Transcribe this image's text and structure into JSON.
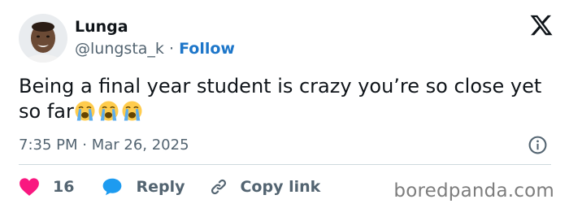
{
  "author": {
    "name": "Lunga",
    "handle": "@lungsta_k",
    "separator": "·",
    "follow_label": "Follow"
  },
  "tweet": {
    "text": "Being a final year student is crazy you’re so close yet so far",
    "emojis": [
      "loudly-crying-face",
      "loudly-crying-face",
      "loudly-crying-face"
    ],
    "timestamp": "7:35 PM · Mar 26, 2025"
  },
  "actions": {
    "like_count": "16",
    "reply_label": "Reply",
    "copy_link_label": "Copy link"
  },
  "watermark": "boredpanda.com",
  "colors": {
    "text": "#0f1419",
    "secondary": "#536471",
    "follow": "#1d76c9",
    "like": "#f91880",
    "reply": "#1d9bf0",
    "divider": "#cfd9de"
  }
}
